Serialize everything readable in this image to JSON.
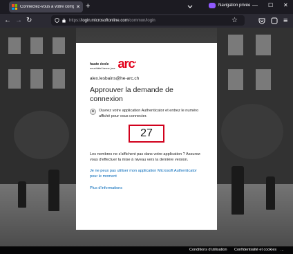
{
  "browser": {
    "tab_title": "Connectez-vous à votre compte",
    "tab_close": "✕",
    "new_tab": "+",
    "private_label": "Navigation privée",
    "minimize": "—",
    "maximize": "☐",
    "close": "✕",
    "back": "←",
    "forward": "→",
    "reload": "↻",
    "url_scheme": "https://",
    "url_host": "login.microsoftonline.com",
    "url_path": "/common/login",
    "bookmark": "☆",
    "menu": "≡"
  },
  "card": {
    "logo_small_line1": "haute école",
    "logo_small_line2": "neuchâtel berne jura",
    "logo_text": "arc",
    "logo_degree": "°",
    "brand_color": "#e2001a",
    "email": "alex.lesbains@he-arc.ch",
    "heading": "Approuver la demande de connexion",
    "instruction": "Ouvrez votre application Authenticator et entrez le numéro affiché pour vous connecter.",
    "number": "27",
    "help_text": "Les nombres ne s'affichent pas dans votre application ? Assurez-vous d'effectuer la mise à niveau vers la dernière version.",
    "link_no_app": "Je ne peux pas utiliser mon application Microsoft Authenticator pour le moment",
    "link_more": "Plus d'informations"
  },
  "footer": {
    "terms": "Conditions d'utilisation",
    "privacy": "Confidentialité et cookies",
    "more": "..."
  }
}
